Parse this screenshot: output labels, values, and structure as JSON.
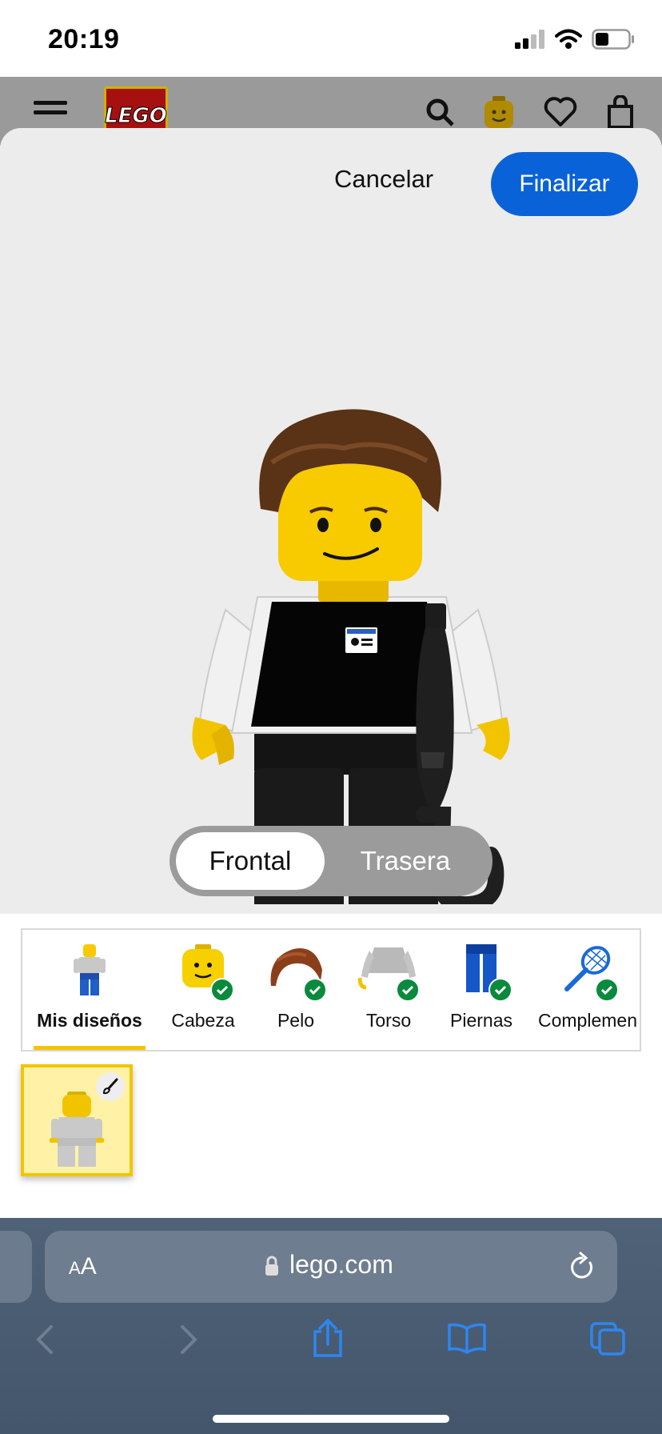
{
  "status_bar": {
    "time": "20:19",
    "battery_percent": 40
  },
  "site_header": {
    "logo_text": "LEGO"
  },
  "modal": {
    "cancel_label": "Cancelar",
    "finish_label": "Finalizar",
    "view_toggle": {
      "front_label": "Frontal",
      "back_label": "Trasera",
      "selected": "Frontal"
    }
  },
  "tabs": [
    {
      "label": "Mis diseños",
      "icon": "minifigure-icon",
      "active": true,
      "checked": false
    },
    {
      "label": "Cabeza",
      "icon": "head-icon",
      "active": false,
      "checked": true
    },
    {
      "label": "Pelo",
      "icon": "hair-icon",
      "active": false,
      "checked": true
    },
    {
      "label": "Torso",
      "icon": "torso-icon",
      "active": false,
      "checked": true
    },
    {
      "label": "Piernas",
      "icon": "legs-icon",
      "active": false,
      "checked": true
    },
    {
      "label": "Complemen",
      "icon": "racket-icon",
      "active": false,
      "checked": true
    }
  ],
  "designs": [
    {
      "icon": "minifigure-icon",
      "editable": true,
      "selected": true
    }
  ],
  "browser": {
    "text_size_label_small": "A",
    "text_size_label_large": "A",
    "url": "lego.com"
  },
  "colors": {
    "accent": "#0a62d8",
    "active_tab": "#f5c400",
    "check": "#0a8a3d"
  }
}
